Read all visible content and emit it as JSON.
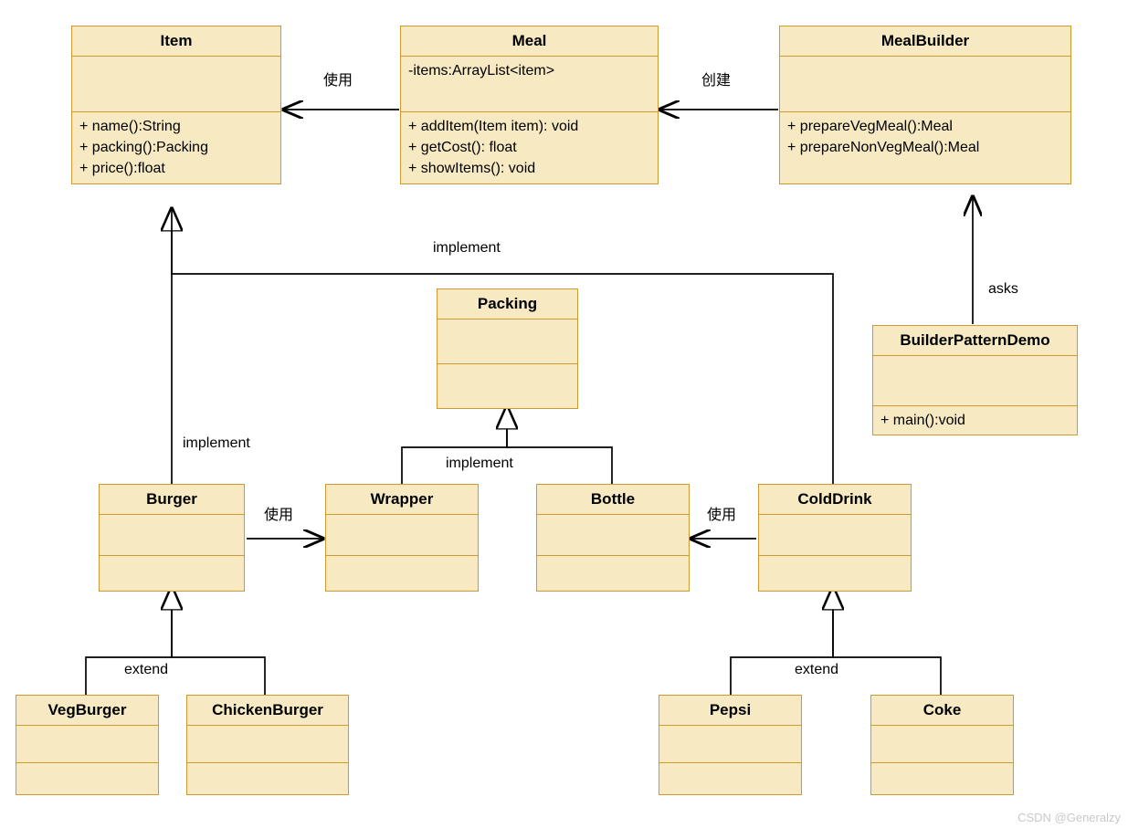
{
  "classes": {
    "Item": {
      "name": "Item",
      "attrs": "",
      "ops": "+ name():String\n+ packing():Packing\n+ price():float"
    },
    "Meal": {
      "name": "Meal",
      "attrs": "-items:ArrayList<item>",
      "ops": "+ addItem(Item item): void\n+ getCost(): float\n+ showItems(): void"
    },
    "MealBuilder": {
      "name": "MealBuilder",
      "attrs": "",
      "ops": "+ prepareVegMeal():Meal\n+ prepareNonVegMeal():Meal"
    },
    "Packing": {
      "name": "Packing",
      "attrs": "",
      "ops": ""
    },
    "BuilderPatternDemo": {
      "name": "BuilderPatternDemo",
      "attrs": "",
      "ops": "+ main():void"
    },
    "Burger": {
      "name": "Burger",
      "attrs": "",
      "ops": ""
    },
    "Wrapper": {
      "name": "Wrapper",
      "attrs": "",
      "ops": ""
    },
    "Bottle": {
      "name": "Bottle",
      "attrs": "",
      "ops": ""
    },
    "ColdDrink": {
      "name": "ColdDrink",
      "attrs": "",
      "ops": ""
    },
    "VegBurger": {
      "name": "VegBurger",
      "attrs": "",
      "ops": ""
    },
    "ChickenBurger": {
      "name": "ChickenBurger",
      "attrs": "",
      "ops": ""
    },
    "Pepsi": {
      "name": "Pepsi",
      "attrs": "",
      "ops": ""
    },
    "Coke": {
      "name": "Coke",
      "attrs": "",
      "ops": ""
    }
  },
  "labels": {
    "use1": "使用",
    "create": "创建",
    "implement1": "implement",
    "implement2": "implement",
    "implement3": "implement",
    "asks": "asks",
    "use2": "使用",
    "use3": "使用",
    "extend1": "extend",
    "extend2": "extend"
  },
  "watermark": "CSDN @Generalzy"
}
